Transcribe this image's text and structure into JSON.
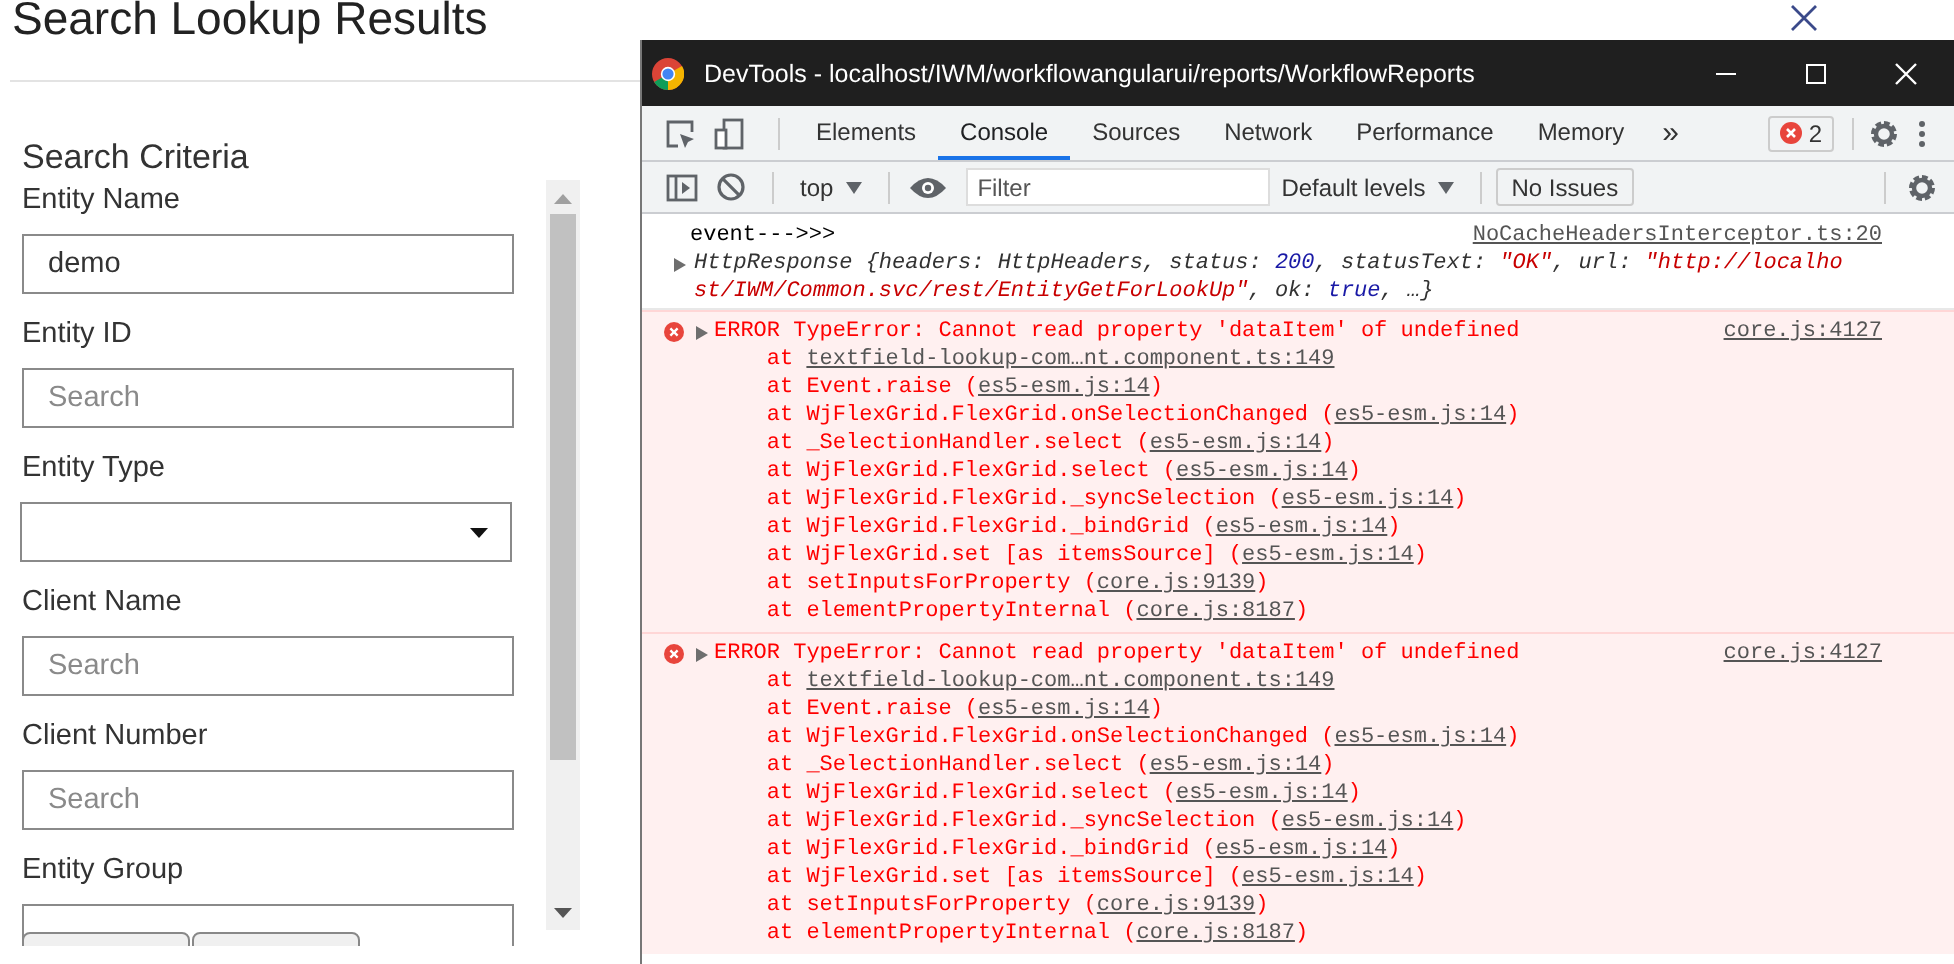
{
  "page": {
    "title": "Search Lookup Results",
    "section_title": "Search Criteria",
    "fields": [
      {
        "label": "Entity Name",
        "kind": "text",
        "value": "demo"
      },
      {
        "label": "Entity ID",
        "kind": "text",
        "placeholder": "Search"
      },
      {
        "label": "Entity Type",
        "kind": "select"
      },
      {
        "label": "Client Name",
        "kind": "text",
        "placeholder": "Search"
      },
      {
        "label": "Client Number",
        "kind": "text",
        "placeholder": "Search"
      },
      {
        "label": "Entity Group",
        "kind": "text"
      }
    ]
  },
  "devtools": {
    "title": "DevTools - localhost/IWM/workflowangularui/reports/WorkflowReports",
    "tabs": [
      {
        "label": "Elements",
        "selected": false
      },
      {
        "label": "Console",
        "selected": true
      },
      {
        "label": "Sources",
        "selected": false
      },
      {
        "label": "Network",
        "selected": false
      },
      {
        "label": "Performance",
        "selected": false
      },
      {
        "label": "Memory",
        "selected": false
      }
    ],
    "more_tabs": "»",
    "error_count": "2",
    "toolbar": {
      "context": "top",
      "filter_placeholder": "Filter",
      "levels": "Default levels",
      "issues": "No Issues"
    },
    "messages": [
      {
        "kind": "log",
        "text": "event--->>>",
        "source": "NoCacheHeadersInterceptor.ts:20"
      },
      {
        "kind": "object",
        "parts": [
          {
            "kind": "plain",
            "text": "HttpResponse {headers: HttpHeaders, status: "
          },
          {
            "kind": "number",
            "text": "200"
          },
          {
            "kind": "plain",
            "text": ", statusText: "
          },
          {
            "kind": "string",
            "text": "\"OK\""
          },
          {
            "kind": "plain",
            "text": ", url: "
          },
          {
            "kind": "string",
            "text": "\"http://localhost/IWM/Common.svc/rest/EntityGetForLookUp\""
          },
          {
            "kind": "plain",
            "text": ", ok: "
          },
          {
            "kind": "number",
            "text": "true"
          },
          {
            "kind": "plain",
            "text": ", …}"
          }
        ]
      },
      {
        "kind": "error",
        "text": "ERROR TypeError: Cannot read property 'dataItem' of undefined",
        "source": "core.js:4127",
        "frames": [
          {
            "before": "at ",
            "link": "textfield-lookup-com…nt.component.ts:149"
          },
          {
            "before": "at Event.raise (",
            "link": "es5-esm.js:14",
            "after": ")"
          },
          {
            "before": "at WjFlexGrid.FlexGrid.onSelectionChanged (",
            "link": "es5-esm.js:14",
            "after": ")"
          },
          {
            "before": "at _SelectionHandler.select (",
            "link": "es5-esm.js:14",
            "after": ")"
          },
          {
            "before": "at WjFlexGrid.FlexGrid.select (",
            "link": "es5-esm.js:14",
            "after": ")"
          },
          {
            "before": "at WjFlexGrid.FlexGrid._syncSelection (",
            "link": "es5-esm.js:14",
            "after": ")"
          },
          {
            "before": "at WjFlexGrid.FlexGrid._bindGrid (",
            "link": "es5-esm.js:14",
            "after": ")"
          },
          {
            "before": "at WjFlexGrid.set [as itemsSource] (",
            "link": "es5-esm.js:14",
            "after": ")"
          },
          {
            "before": "at setInputsForProperty (",
            "link": "core.js:9139",
            "after": ")"
          },
          {
            "before": "at elementPropertyInternal (",
            "link": "core.js:8187",
            "after": ")"
          }
        ]
      },
      {
        "kind": "error",
        "text": "ERROR TypeError: Cannot read property 'dataItem' of undefined",
        "source": "core.js:4127",
        "frames": [
          {
            "before": "at ",
            "link": "textfield-lookup-com…nt.component.ts:149"
          },
          {
            "before": "at Event.raise (",
            "link": "es5-esm.js:14",
            "after": ")"
          },
          {
            "before": "at WjFlexGrid.FlexGrid.onSelectionChanged (",
            "link": "es5-esm.js:14",
            "after": ")"
          },
          {
            "before": "at _SelectionHandler.select (",
            "link": "es5-esm.js:14",
            "after": ")"
          },
          {
            "before": "at WjFlexGrid.FlexGrid.select (",
            "link": "es5-esm.js:14",
            "after": ")"
          },
          {
            "before": "at WjFlexGrid.FlexGrid._syncSelection (",
            "link": "es5-esm.js:14",
            "after": ")"
          },
          {
            "before": "at WjFlexGrid.FlexGrid._bindGrid (",
            "link": "es5-esm.js:14",
            "after": ")"
          },
          {
            "before": "at WjFlexGrid.set [as itemsSource] (",
            "link": "es5-esm.js:14",
            "after": ")"
          },
          {
            "before": "at setInputsForProperty (",
            "link": "core.js:9139",
            "after": ")"
          },
          {
            "before": "at elementPropertyInternal (",
            "link": "core.js:8187",
            "after": ")"
          }
        ]
      }
    ]
  }
}
